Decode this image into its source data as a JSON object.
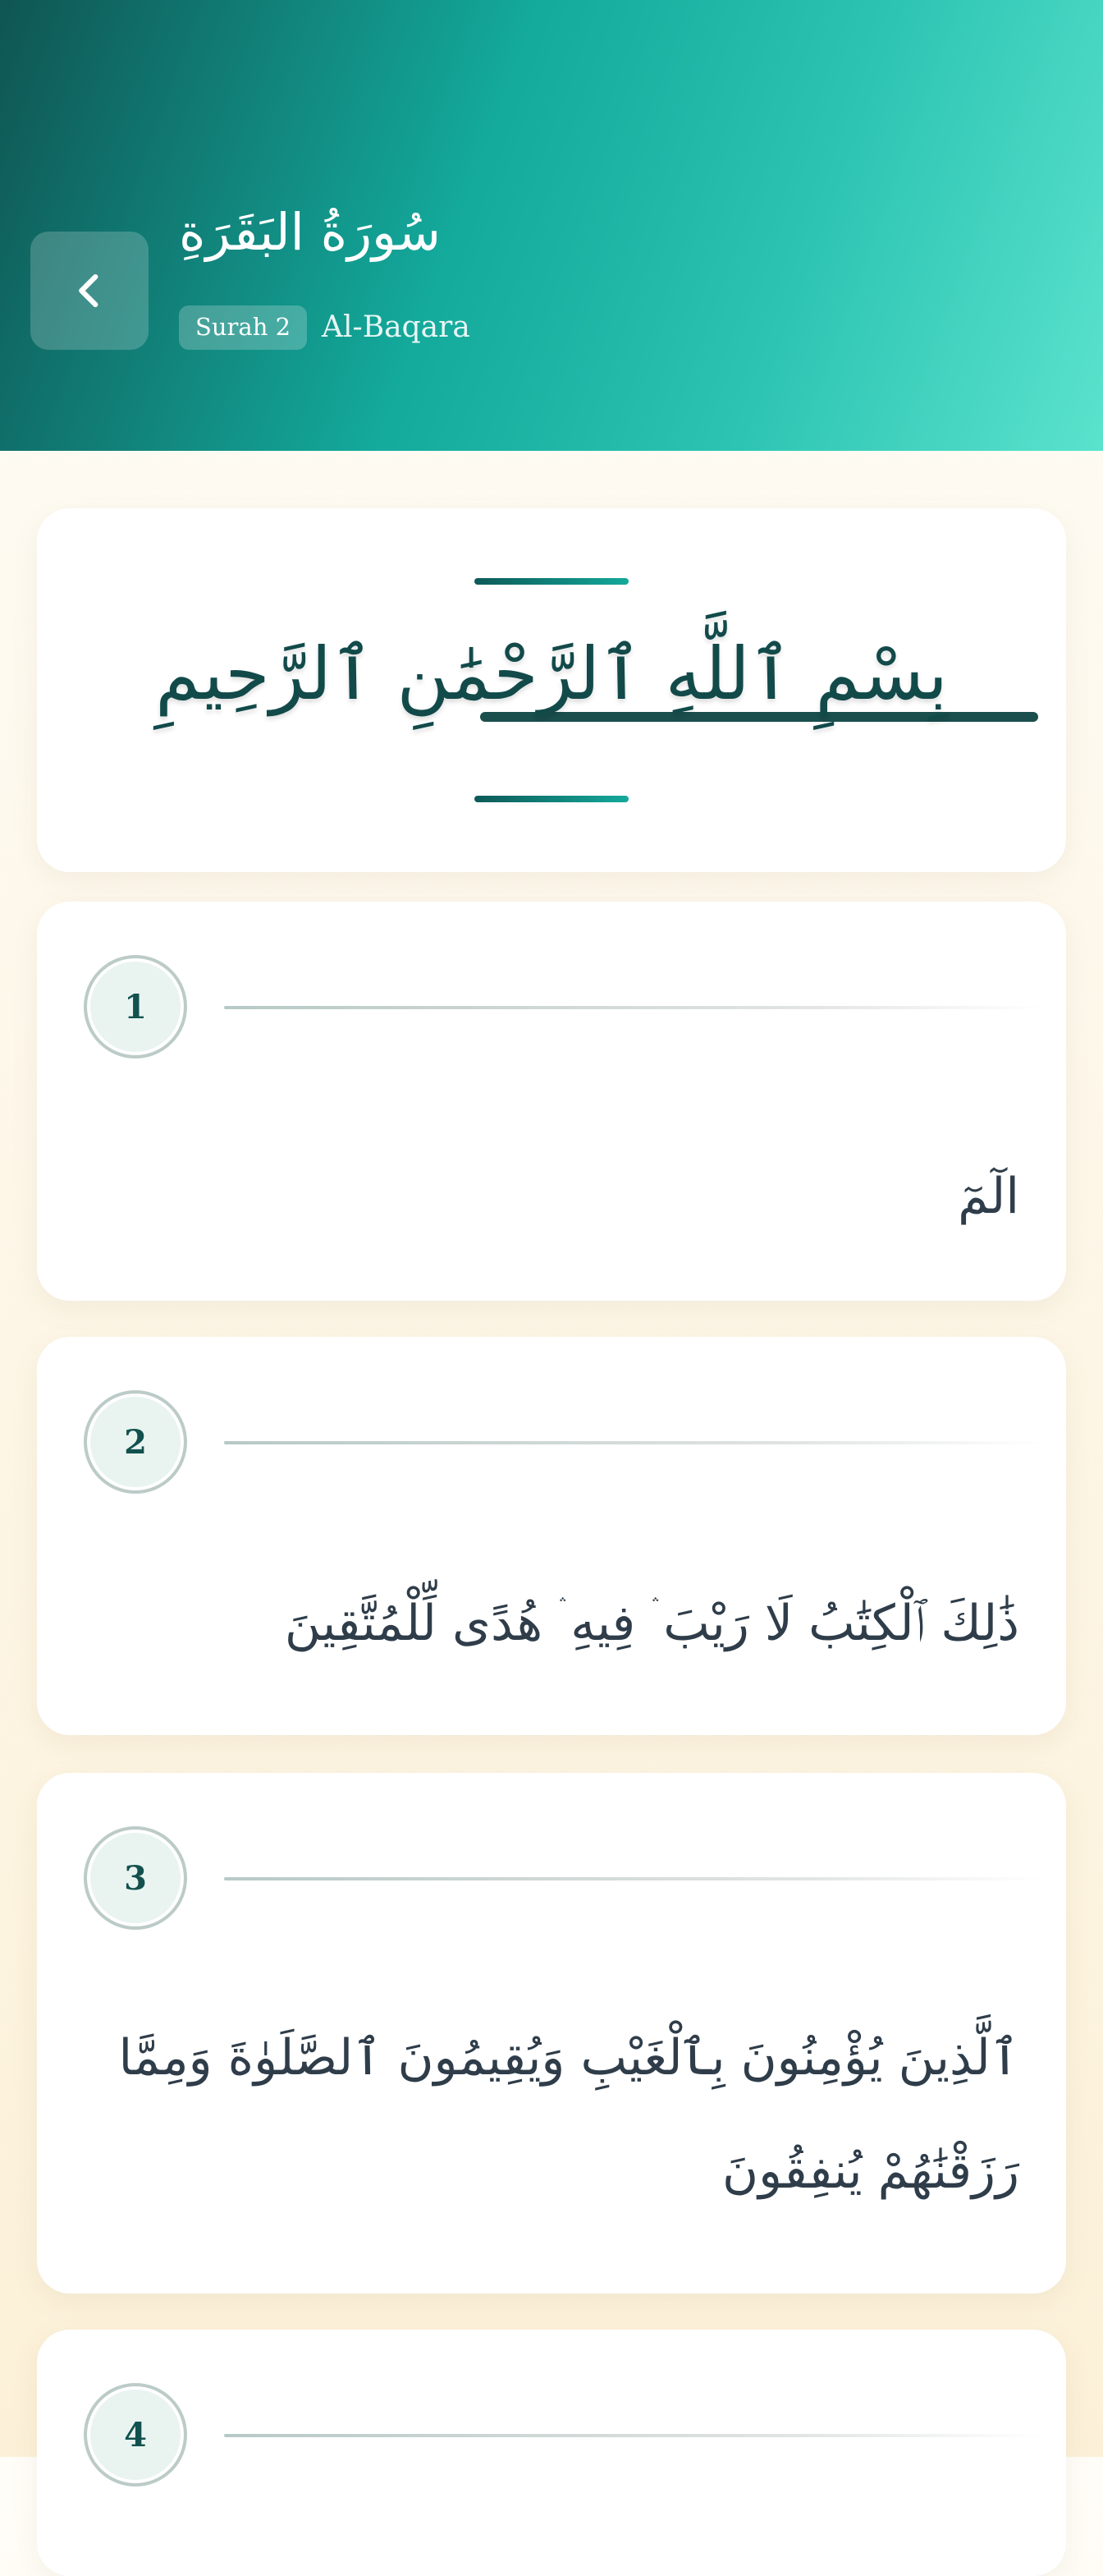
{
  "header": {
    "title_ar": "سُورَةُ البَقَرَةِ",
    "badge": "Surah 2",
    "title_en": "Al-Baqara",
    "back_icon": "chevron-left-icon",
    "gradient": [
      "#0f5553",
      "#13a99b",
      "#5ae3cd"
    ]
  },
  "bismillah": {
    "text": "بِسْمِ ٱللَّهِ ٱلرَّحْمَٰنِ ٱلرَّحِيمِ"
  },
  "verses": [
    {
      "number": "1",
      "text": "الٓمٓ"
    },
    {
      "number": "2",
      "text": "ذَٰلِكَ ٱلْكِتَٰبُ لَا رَيْبَ ۛ فِيهِ ۛ هُدًى لِّلْمُتَّقِينَ"
    },
    {
      "number": "3",
      "text": "ٱلَّذِينَ يُؤْمِنُونَ بِٱلْغَيْبِ وَيُقِيمُونَ ٱلصَّلَوٰةَ وَمِمَّا رَزَقْنَٰهُمْ يُنفِقُونَ"
    },
    {
      "number": "4",
      "text": ""
    }
  ],
  "colors": {
    "accent": "#13a99b",
    "accent_dark": "#0d5a58",
    "verse_text": "#2f3d4a",
    "background": "#fdf6e6"
  }
}
